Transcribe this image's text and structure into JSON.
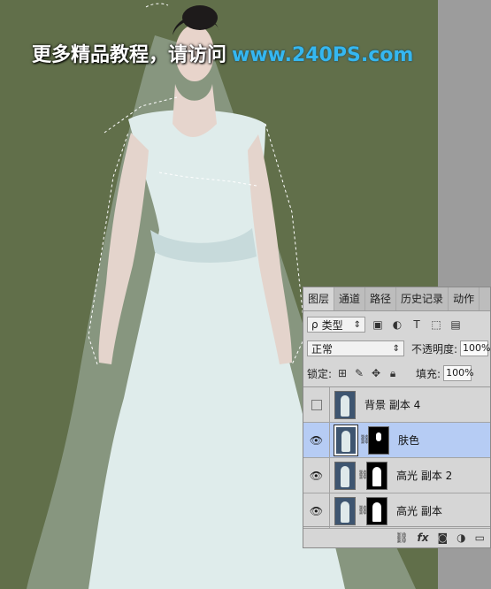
{
  "watermark": {
    "chinese_text": "更多精品教程，请访问",
    "url": "www.240PS.com"
  },
  "layers_panel": {
    "tabs": [
      {
        "label": "图层",
        "active": true
      },
      {
        "label": "通道",
        "active": false
      },
      {
        "label": "路径",
        "active": false
      },
      {
        "label": "历史记录",
        "active": false
      },
      {
        "label": "动作",
        "active": false
      }
    ],
    "filter": {
      "prefix": "ρ",
      "kind": "类型",
      "arrow": "⇕"
    },
    "filter_icons": [
      "image-icon",
      "adjustment-circle-icon",
      "text-icon",
      "shape-icon",
      "smart-object-icon"
    ],
    "blend_mode": {
      "value": "正常",
      "arrow": "⇕"
    },
    "opacity": {
      "label": "不透明度:",
      "value": "100%"
    },
    "lock": {
      "label": "锁定:"
    },
    "fill": {
      "label": "填充:",
      "value": "100%"
    },
    "layers": [
      {
        "name": "背景 副本 4",
        "visible": false,
        "has_mask": false,
        "selected": false
      },
      {
        "name": "肤色",
        "visible": true,
        "has_mask": true,
        "mask_type": "small",
        "selected": true
      },
      {
        "name": "高光 副本 2",
        "visible": true,
        "has_mask": true,
        "mask_type": "full",
        "selected": false
      },
      {
        "name": "高光 副本",
        "visible": true,
        "has_mask": true,
        "mask_type": "full",
        "selected": false
      }
    ],
    "bottom_icons": [
      "link-icon",
      "fx-icon",
      "add-mask-icon",
      "adjustment-icon",
      "new-group-icon"
    ],
    "bottom_fx": "fx"
  },
  "colors": {
    "canvas_bg": "#616f4a",
    "panel_bg": "#d6d6d6",
    "selected_layer": "#b6ccf4",
    "watermark_url": "#35b7f0"
  }
}
